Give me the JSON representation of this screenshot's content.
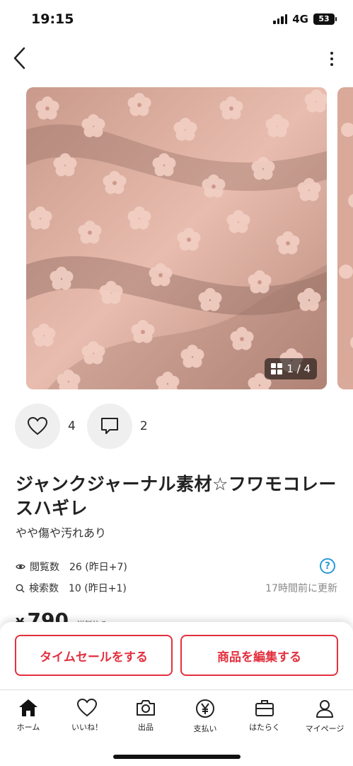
{
  "status_bar": {
    "time": "19:15",
    "network": "4G",
    "battery": "53"
  },
  "header": {
    "back_icon": "chevron-left-icon",
    "more_icon": "more-vertical-icon"
  },
  "image": {
    "counter": "1 / 4",
    "dominant_color": "#e6b7a8"
  },
  "social": {
    "likes": "4",
    "comments": "2"
  },
  "item": {
    "title": "ジャンクジャーナル素材☆フワモコレースハギレ",
    "condition": "やや傷や汚れあり"
  },
  "stats": {
    "views_label": "閲覧数",
    "views_value": "26 (昨日+7)",
    "search_label": "検索数",
    "search_value": "10 (昨日+1)",
    "help": "?",
    "updated": "17時間前に更新"
  },
  "price": {
    "currency": "¥",
    "amount": "790",
    "shipping": "送料込み"
  },
  "actions": {
    "timesale": "タイムセールをする",
    "edit": "商品を編集する"
  },
  "tabs": [
    {
      "label": "ホーム",
      "icon": "home-icon"
    },
    {
      "label": "いいね！",
      "icon": "heart-icon"
    },
    {
      "label": "出品",
      "icon": "camera-icon"
    },
    {
      "label": "支払い",
      "icon": "yen-icon"
    },
    {
      "label": "はたらく",
      "icon": "briefcase-icon"
    },
    {
      "label": "マイページ",
      "icon": "person-icon"
    }
  ],
  "colors": {
    "accent": "#e3303f",
    "help_blue": "#2a9ad7"
  }
}
